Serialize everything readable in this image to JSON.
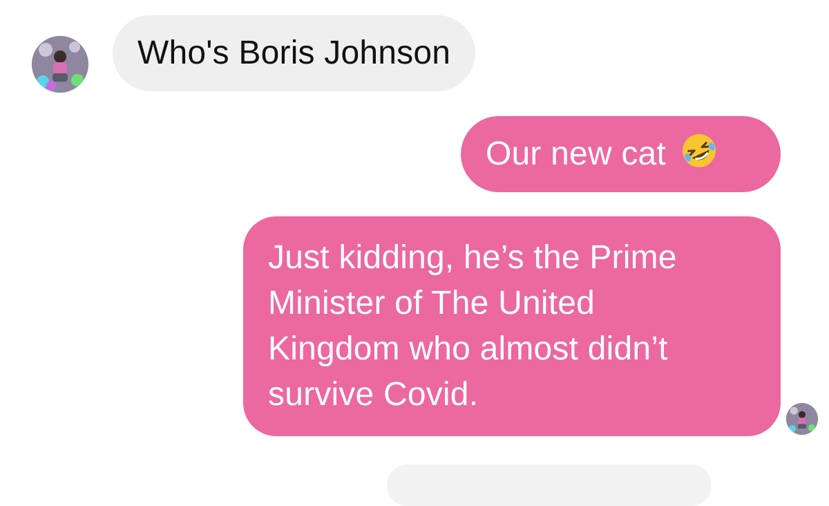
{
  "thread": {
    "messages": [
      {
        "sender": "them",
        "text": "Who's Boris Johnson"
      },
      {
        "sender": "me",
        "text": "Our new cat",
        "emoji": "rolling-on-floor-laughing-emoji"
      },
      {
        "sender": "me",
        "lines": [
          "Just kidding, he’s the Prime",
          "Minister of The United",
          "Kingdom who almost didn’t",
          "survive Covid."
        ]
      }
    ]
  },
  "colors": {
    "incoming_bubble": "#efefef",
    "outgoing_bubble": "#eb68a0",
    "incoming_text": "#111111",
    "outgoing_text": "#ffffff"
  }
}
